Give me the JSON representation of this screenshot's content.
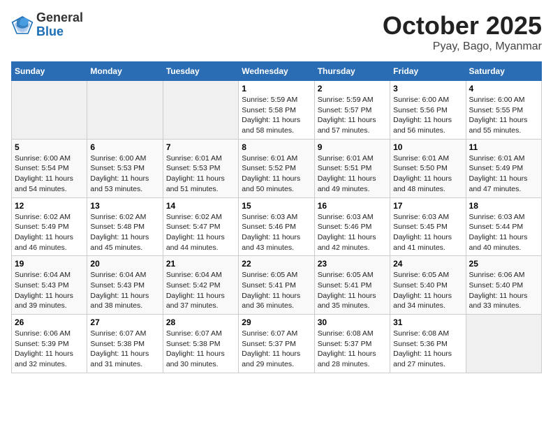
{
  "header": {
    "logo": {
      "general": "General",
      "blue": "Blue"
    },
    "title": "October 2025",
    "location": "Pyay, Bago, Myanmar"
  },
  "weekdays": [
    "Sunday",
    "Monday",
    "Tuesday",
    "Wednesday",
    "Thursday",
    "Friday",
    "Saturday"
  ],
  "weeks": [
    [
      {
        "day": "",
        "info": ""
      },
      {
        "day": "",
        "info": ""
      },
      {
        "day": "",
        "info": ""
      },
      {
        "day": "1",
        "info": "Sunrise: 5:59 AM\nSunset: 5:58 PM\nDaylight: 11 hours and 58 minutes."
      },
      {
        "day": "2",
        "info": "Sunrise: 5:59 AM\nSunset: 5:57 PM\nDaylight: 11 hours and 57 minutes."
      },
      {
        "day": "3",
        "info": "Sunrise: 6:00 AM\nSunset: 5:56 PM\nDaylight: 11 hours and 56 minutes."
      },
      {
        "day": "4",
        "info": "Sunrise: 6:00 AM\nSunset: 5:55 PM\nDaylight: 11 hours and 55 minutes."
      }
    ],
    [
      {
        "day": "5",
        "info": "Sunrise: 6:00 AM\nSunset: 5:54 PM\nDaylight: 11 hours and 54 minutes."
      },
      {
        "day": "6",
        "info": "Sunrise: 6:00 AM\nSunset: 5:53 PM\nDaylight: 11 hours and 53 minutes."
      },
      {
        "day": "7",
        "info": "Sunrise: 6:01 AM\nSunset: 5:53 PM\nDaylight: 11 hours and 51 minutes."
      },
      {
        "day": "8",
        "info": "Sunrise: 6:01 AM\nSunset: 5:52 PM\nDaylight: 11 hours and 50 minutes."
      },
      {
        "day": "9",
        "info": "Sunrise: 6:01 AM\nSunset: 5:51 PM\nDaylight: 11 hours and 49 minutes."
      },
      {
        "day": "10",
        "info": "Sunrise: 6:01 AM\nSunset: 5:50 PM\nDaylight: 11 hours and 48 minutes."
      },
      {
        "day": "11",
        "info": "Sunrise: 6:01 AM\nSunset: 5:49 PM\nDaylight: 11 hours and 47 minutes."
      }
    ],
    [
      {
        "day": "12",
        "info": "Sunrise: 6:02 AM\nSunset: 5:49 PM\nDaylight: 11 hours and 46 minutes."
      },
      {
        "day": "13",
        "info": "Sunrise: 6:02 AM\nSunset: 5:48 PM\nDaylight: 11 hours and 45 minutes."
      },
      {
        "day": "14",
        "info": "Sunrise: 6:02 AM\nSunset: 5:47 PM\nDaylight: 11 hours and 44 minutes."
      },
      {
        "day": "15",
        "info": "Sunrise: 6:03 AM\nSunset: 5:46 PM\nDaylight: 11 hours and 43 minutes."
      },
      {
        "day": "16",
        "info": "Sunrise: 6:03 AM\nSunset: 5:46 PM\nDaylight: 11 hours and 42 minutes."
      },
      {
        "day": "17",
        "info": "Sunrise: 6:03 AM\nSunset: 5:45 PM\nDaylight: 11 hours and 41 minutes."
      },
      {
        "day": "18",
        "info": "Sunrise: 6:03 AM\nSunset: 5:44 PM\nDaylight: 11 hours and 40 minutes."
      }
    ],
    [
      {
        "day": "19",
        "info": "Sunrise: 6:04 AM\nSunset: 5:43 PM\nDaylight: 11 hours and 39 minutes."
      },
      {
        "day": "20",
        "info": "Sunrise: 6:04 AM\nSunset: 5:43 PM\nDaylight: 11 hours and 38 minutes."
      },
      {
        "day": "21",
        "info": "Sunrise: 6:04 AM\nSunset: 5:42 PM\nDaylight: 11 hours and 37 minutes."
      },
      {
        "day": "22",
        "info": "Sunrise: 6:05 AM\nSunset: 5:41 PM\nDaylight: 11 hours and 36 minutes."
      },
      {
        "day": "23",
        "info": "Sunrise: 6:05 AM\nSunset: 5:41 PM\nDaylight: 11 hours and 35 minutes."
      },
      {
        "day": "24",
        "info": "Sunrise: 6:05 AM\nSunset: 5:40 PM\nDaylight: 11 hours and 34 minutes."
      },
      {
        "day": "25",
        "info": "Sunrise: 6:06 AM\nSunset: 5:40 PM\nDaylight: 11 hours and 33 minutes."
      }
    ],
    [
      {
        "day": "26",
        "info": "Sunrise: 6:06 AM\nSunset: 5:39 PM\nDaylight: 11 hours and 32 minutes."
      },
      {
        "day": "27",
        "info": "Sunrise: 6:07 AM\nSunset: 5:38 PM\nDaylight: 11 hours and 31 minutes."
      },
      {
        "day": "28",
        "info": "Sunrise: 6:07 AM\nSunset: 5:38 PM\nDaylight: 11 hours and 30 minutes."
      },
      {
        "day": "29",
        "info": "Sunrise: 6:07 AM\nSunset: 5:37 PM\nDaylight: 11 hours and 29 minutes."
      },
      {
        "day": "30",
        "info": "Sunrise: 6:08 AM\nSunset: 5:37 PM\nDaylight: 11 hours and 28 minutes."
      },
      {
        "day": "31",
        "info": "Sunrise: 6:08 AM\nSunset: 5:36 PM\nDaylight: 11 hours and 27 minutes."
      },
      {
        "day": "",
        "info": ""
      }
    ]
  ]
}
